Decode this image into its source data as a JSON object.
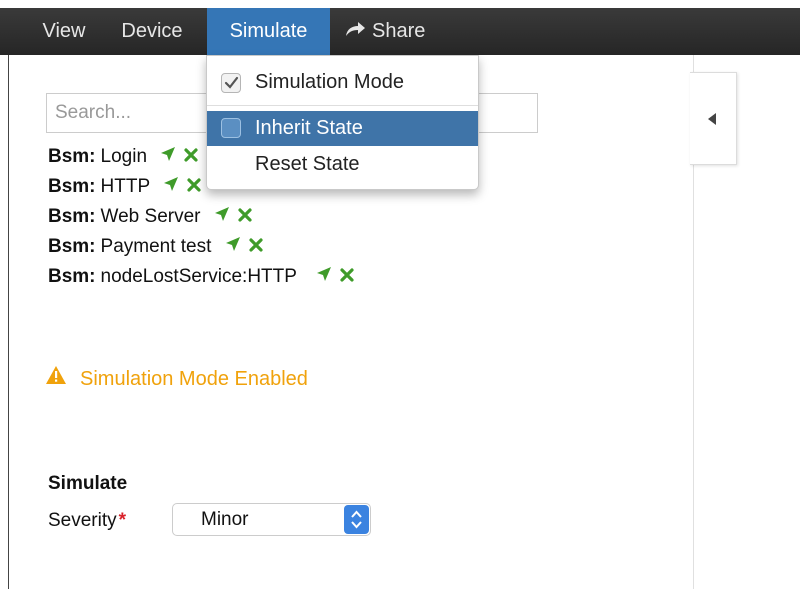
{
  "nav": {
    "items": [
      {
        "label": "View"
      },
      {
        "label": "Device"
      },
      {
        "label": "Simulate",
        "active": true
      },
      {
        "label": "Share",
        "icon": "share-arrow-icon"
      }
    ]
  },
  "search": {
    "placeholder": "Search..."
  },
  "bsm_list": {
    "prefix": "Bsm:",
    "items": [
      {
        "name": "Login"
      },
      {
        "name": "HTTP"
      },
      {
        "name": "Web Server"
      },
      {
        "name": "Payment test"
      },
      {
        "name": "nodeLostService:HTTP"
      }
    ],
    "action_icons": [
      "locate-arrow-icon",
      "remove-x-icon"
    ]
  },
  "warning": {
    "text": "Simulation Mode Enabled",
    "icon": "warning-triangle-icon",
    "color": "#f0a20c"
  },
  "simulate_section": {
    "heading": "Simulate",
    "severity_label": "Severity",
    "required_mark": "*",
    "severity_value": "Minor"
  },
  "dropdown": {
    "items": [
      {
        "label": "Simulation Mode",
        "checked": true
      },
      {
        "label": "Inherit State",
        "checked": false,
        "highlighted": true
      },
      {
        "label": "Reset State"
      }
    ]
  },
  "colors": {
    "nav_active": "#3576b6",
    "menu_highlight": "#3f74a8",
    "action_green": "#3f9b2a",
    "warning": "#f0a20c",
    "required": "#d9222a"
  }
}
